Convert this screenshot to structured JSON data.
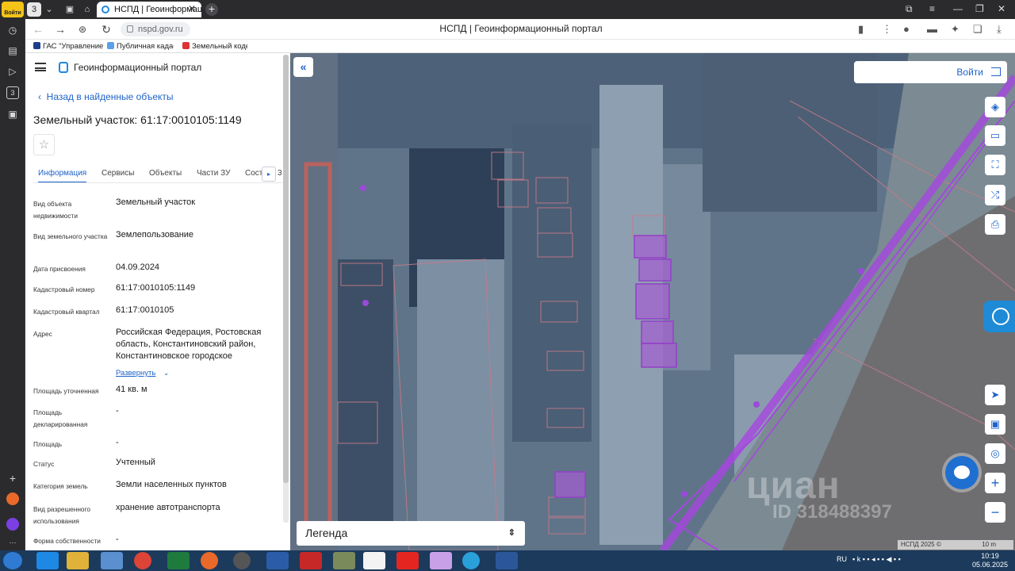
{
  "browser": {
    "voiti_badge": "Войти",
    "tab_count": "3",
    "active_tab_title": "НСПД | Геоинформацио",
    "url": "nspd.gov.ru",
    "page_title": "НСПД | Геоинформационный портал",
    "bookmarks": [
      "ГАС \"Управление",
      "Публичная кадас",
      "Земельный кодек"
    ]
  },
  "panel": {
    "app_title": "Геоинформационный портал",
    "back_link": "Назад в найденные объекты",
    "object_title": "Земельный участок: 61:17:0010105:1149",
    "tabs": [
      "Информация",
      "Сервисы",
      "Объекты",
      "Части ЗУ",
      "Сост"
    ],
    "tab_cutoff": "3",
    "fields": [
      {
        "key": "Вид объекта недвижимости",
        "value": "Земельный участок"
      },
      {
        "key": "Вид земельного участка",
        "value": "Землепользование"
      },
      {
        "key": "Дата присвоения",
        "value": "04.09.2024"
      },
      {
        "key": "Кадастровый номер",
        "value": "61:17:0010105:1149"
      },
      {
        "key": "Кадастровый квартал",
        "value": "61:17:0010105"
      },
      {
        "key": "Адрес",
        "value": "Российская Федерация, Ростовская область, Константиновский район, Константиновское городское"
      },
      {
        "key": "Площадь уточненная",
        "value": "41 кв. м"
      },
      {
        "key": "Площадь декларированная",
        "value": "-"
      },
      {
        "key": "Площадь",
        "value": "-"
      },
      {
        "key": "Статус",
        "value": "Учтенный"
      },
      {
        "key": "Категория земель",
        "value": "Земли населенных пунктов"
      },
      {
        "key": "Вид разрешенного использования",
        "value": "хранение автотранспорта"
      },
      {
        "key": "Форма собственности",
        "value": "-"
      }
    ],
    "expand_label": "Развернуть"
  },
  "map": {
    "login_label": "Войти",
    "legend_label": "Легенда",
    "watermark": "циан",
    "watermark_id": "ID 318488397",
    "attribution": "НСПД 2025 ©",
    "scale_label": "10 m"
  },
  "taskbar": {
    "lang": "RU",
    "time": "10:19",
    "date": "05.06.2025"
  }
}
